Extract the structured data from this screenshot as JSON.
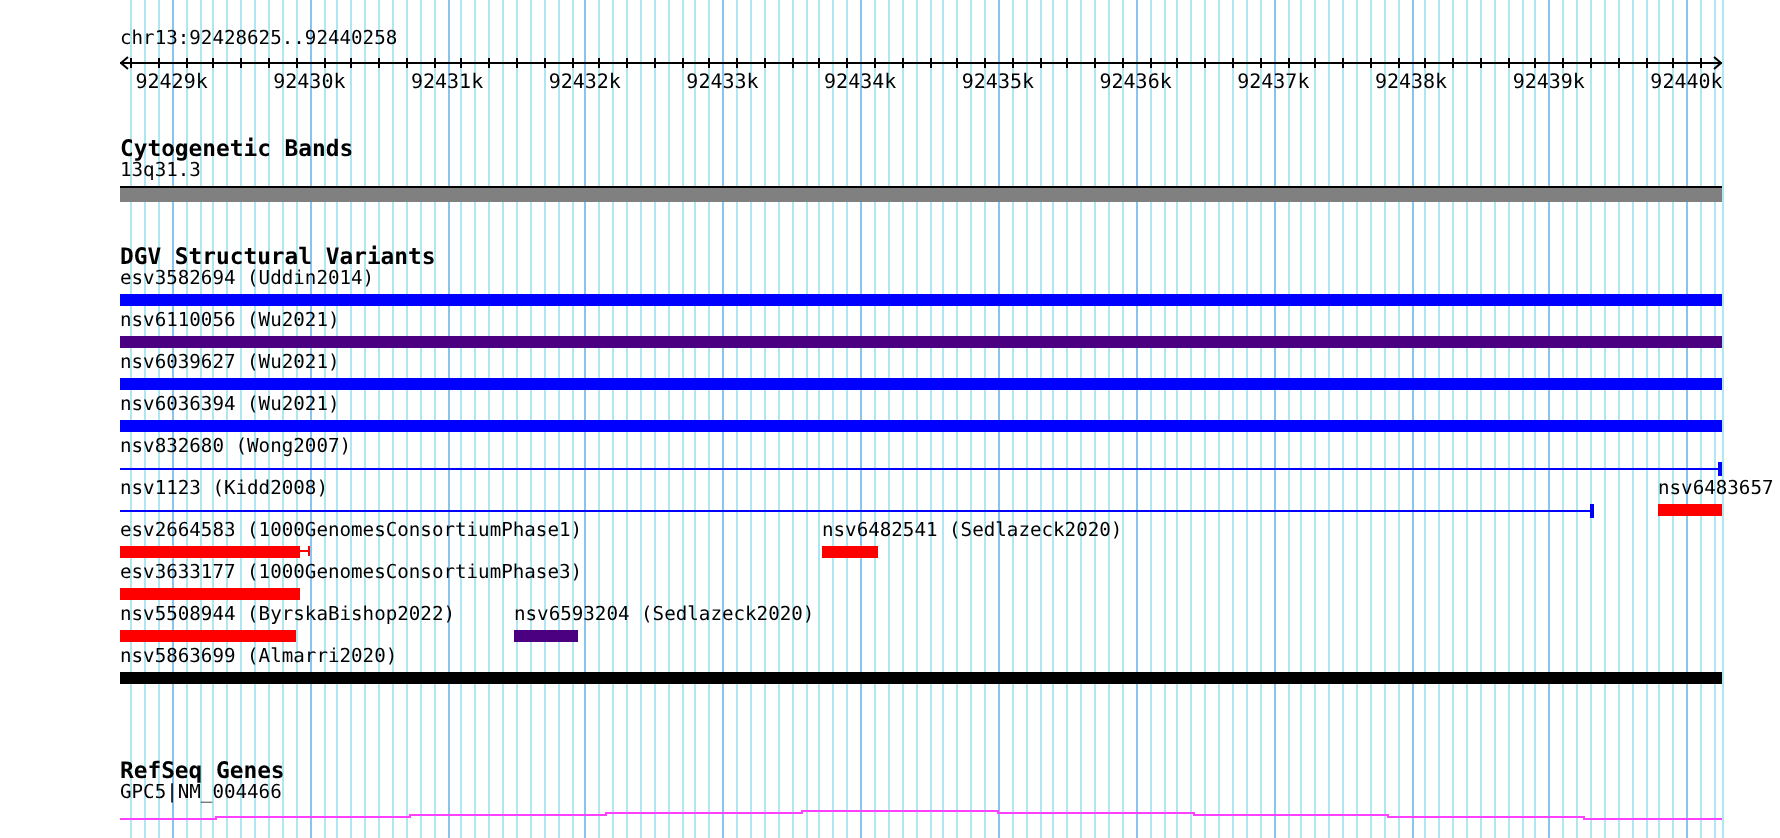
{
  "ruler": {
    "region": "chr13:92428625..92440258",
    "ticks": [
      "92429k",
      "92430k",
      "92431k",
      "92432k",
      "92433k",
      "92434k",
      "92435k",
      "92436k",
      "92437k",
      "92438k",
      "92439k",
      "92440k"
    ]
  },
  "tracks": [
    {
      "kind": "bands",
      "title": "Cytogenetic Bands",
      "label": "13q31.3"
    },
    {
      "kind": "variants",
      "title": "DGV Structural Variants",
      "rows": [
        {
          "features": [
            {
              "label": "esv3582694 (Uddin2014)",
              "kind": "bar",
              "color": "#0000ff"
            }
          ]
        },
        {
          "features": [
            {
              "label": "nsv6110056 (Wu2021)",
              "kind": "bar",
              "color": "#4b0082"
            }
          ]
        },
        {
          "features": [
            {
              "label": "nsv6039627 (Wu2021)",
              "kind": "bar",
              "color": "#0000ff"
            }
          ]
        },
        {
          "features": [
            {
              "label": "nsv6036394 (Wu2021)",
              "kind": "bar",
              "color": "#0000ff"
            }
          ]
        },
        {
          "features": [
            {
              "label": "nsv832680 (Wong2007)",
              "kind": "line",
              "color": "#0000ff"
            }
          ]
        },
        {
          "features": [
            {
              "label": "nsv1123 (Kidd2008)",
              "kind": "line",
              "color": "#0000ff"
            },
            {
              "label": "nsv6483657",
              "kind": "bar",
              "color": "#ff0000"
            }
          ]
        },
        {
          "features": [
            {
              "label": "esv2664583 (1000GenomesConsortiumPhase1)",
              "kind": "bar",
              "color": "#ff0000"
            },
            {
              "label": "nsv6482541 (Sedlazeck2020)",
              "kind": "bar",
              "color": "#ff0000"
            }
          ]
        },
        {
          "features": [
            {
              "label": "esv3633177 (1000GenomesConsortiumPhase3)",
              "kind": "bar",
              "color": "#ff0000"
            }
          ]
        },
        {
          "features": [
            {
              "label": "nsv5508944 (ByrskaBishop2022)",
              "kind": "bar",
              "color": "#ff0000"
            },
            {
              "label": "nsv6593204 (Sedlazeck2020)",
              "kind": "bar",
              "color": "#4b0082"
            }
          ]
        },
        {
          "features": [
            {
              "label": "nsv5863699 (Almarri2020)",
              "kind": "bar",
              "color": "#000000"
            }
          ]
        }
      ]
    },
    {
      "kind": "genes",
      "title": "RefSeq Genes",
      "label": "GPC5|NM_004466"
    }
  ]
}
